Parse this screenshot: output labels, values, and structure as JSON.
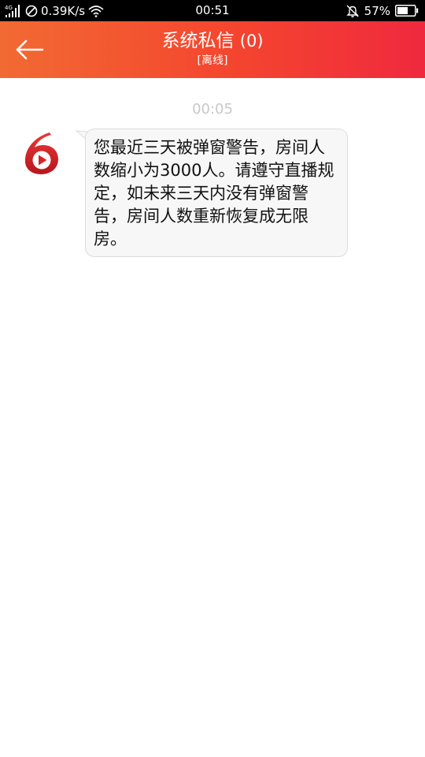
{
  "status_bar": {
    "network_type": "4G",
    "speed": "0.39K/s",
    "time": "00:51",
    "battery": "57%"
  },
  "header": {
    "title": "系统私信",
    "count": "(0)",
    "connection_status": "[离线]"
  },
  "colors": {
    "header_gradient": [
      "#f26a33",
      "#f0293e"
    ],
    "bubble_bg": "#f7f7f7",
    "timestamp": "#c8c8c8",
    "logo_red": "#d7252a"
  },
  "conversation": {
    "timestamp": "00:05",
    "messages": [
      {
        "sender_icon": "six-room-logo-icon",
        "text": "您最近三天被弹窗警告，房间人数缩小为3000人。请遵守直播规定，如未来三天内没有弹窗警告，房间人数重新恢复成无限房。"
      }
    ]
  }
}
